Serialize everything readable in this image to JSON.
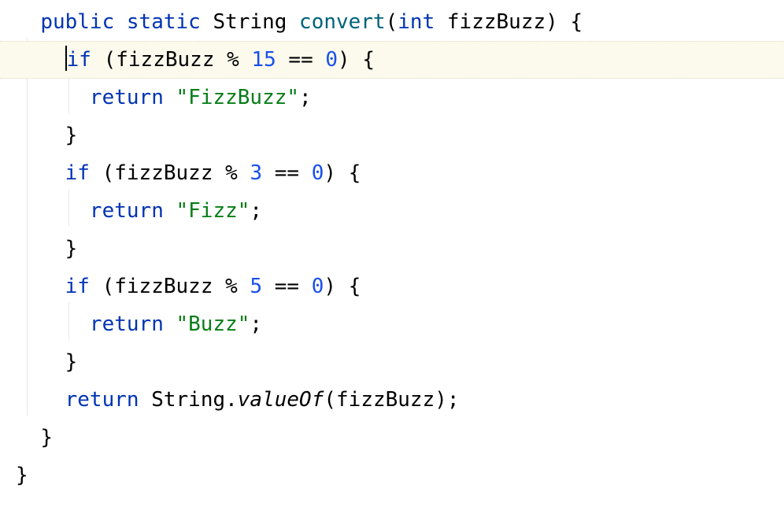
{
  "code": {
    "line1": {
      "kw_public": "public",
      "kw_static": "static",
      "type_string": "String",
      "method": "convert",
      "paren_open": "(",
      "kw_int": "int",
      "param": "fizzBuzz",
      "paren_close": ")",
      "brace_open": "{"
    },
    "line2": {
      "kw_if": "if",
      "paren_open": "(",
      "var": "fizzBuzz",
      "op_mod": "%",
      "num": "15",
      "op_eq": "==",
      "zero": "0",
      "paren_close": ")",
      "brace_open": "{"
    },
    "line3": {
      "kw_return": "return",
      "str": "\"FizzBuzz\"",
      "semi": ";"
    },
    "line4": {
      "brace_close": "}"
    },
    "line5": {
      "kw_if": "if",
      "paren_open": "(",
      "var": "fizzBuzz",
      "op_mod": "%",
      "num": "3",
      "op_eq": "==",
      "zero": "0",
      "paren_close": ")",
      "brace_open": "{"
    },
    "line6": {
      "kw_return": "return",
      "str": "\"Fizz\"",
      "semi": ";"
    },
    "line7": {
      "brace_close": "}"
    },
    "line8": {
      "kw_if": "if",
      "paren_open": "(",
      "var": "fizzBuzz",
      "op_mod": "%",
      "num": "5",
      "op_eq": "==",
      "zero": "0",
      "paren_close": ")",
      "brace_open": "{"
    },
    "line9": {
      "kw_return": "return",
      "str": "\"Buzz\"",
      "semi": ";"
    },
    "line10": {
      "brace_close": "}"
    },
    "line11": {
      "kw_return": "return",
      "type_string": "String",
      "dot": ".",
      "valueOf": "valueOf",
      "paren_open": "(",
      "var": "fizzBuzz",
      "paren_close": ")",
      "semi": ";"
    },
    "line12": {
      "brace_close": "}"
    },
    "line13": {
      "brace_close": "}"
    }
  }
}
